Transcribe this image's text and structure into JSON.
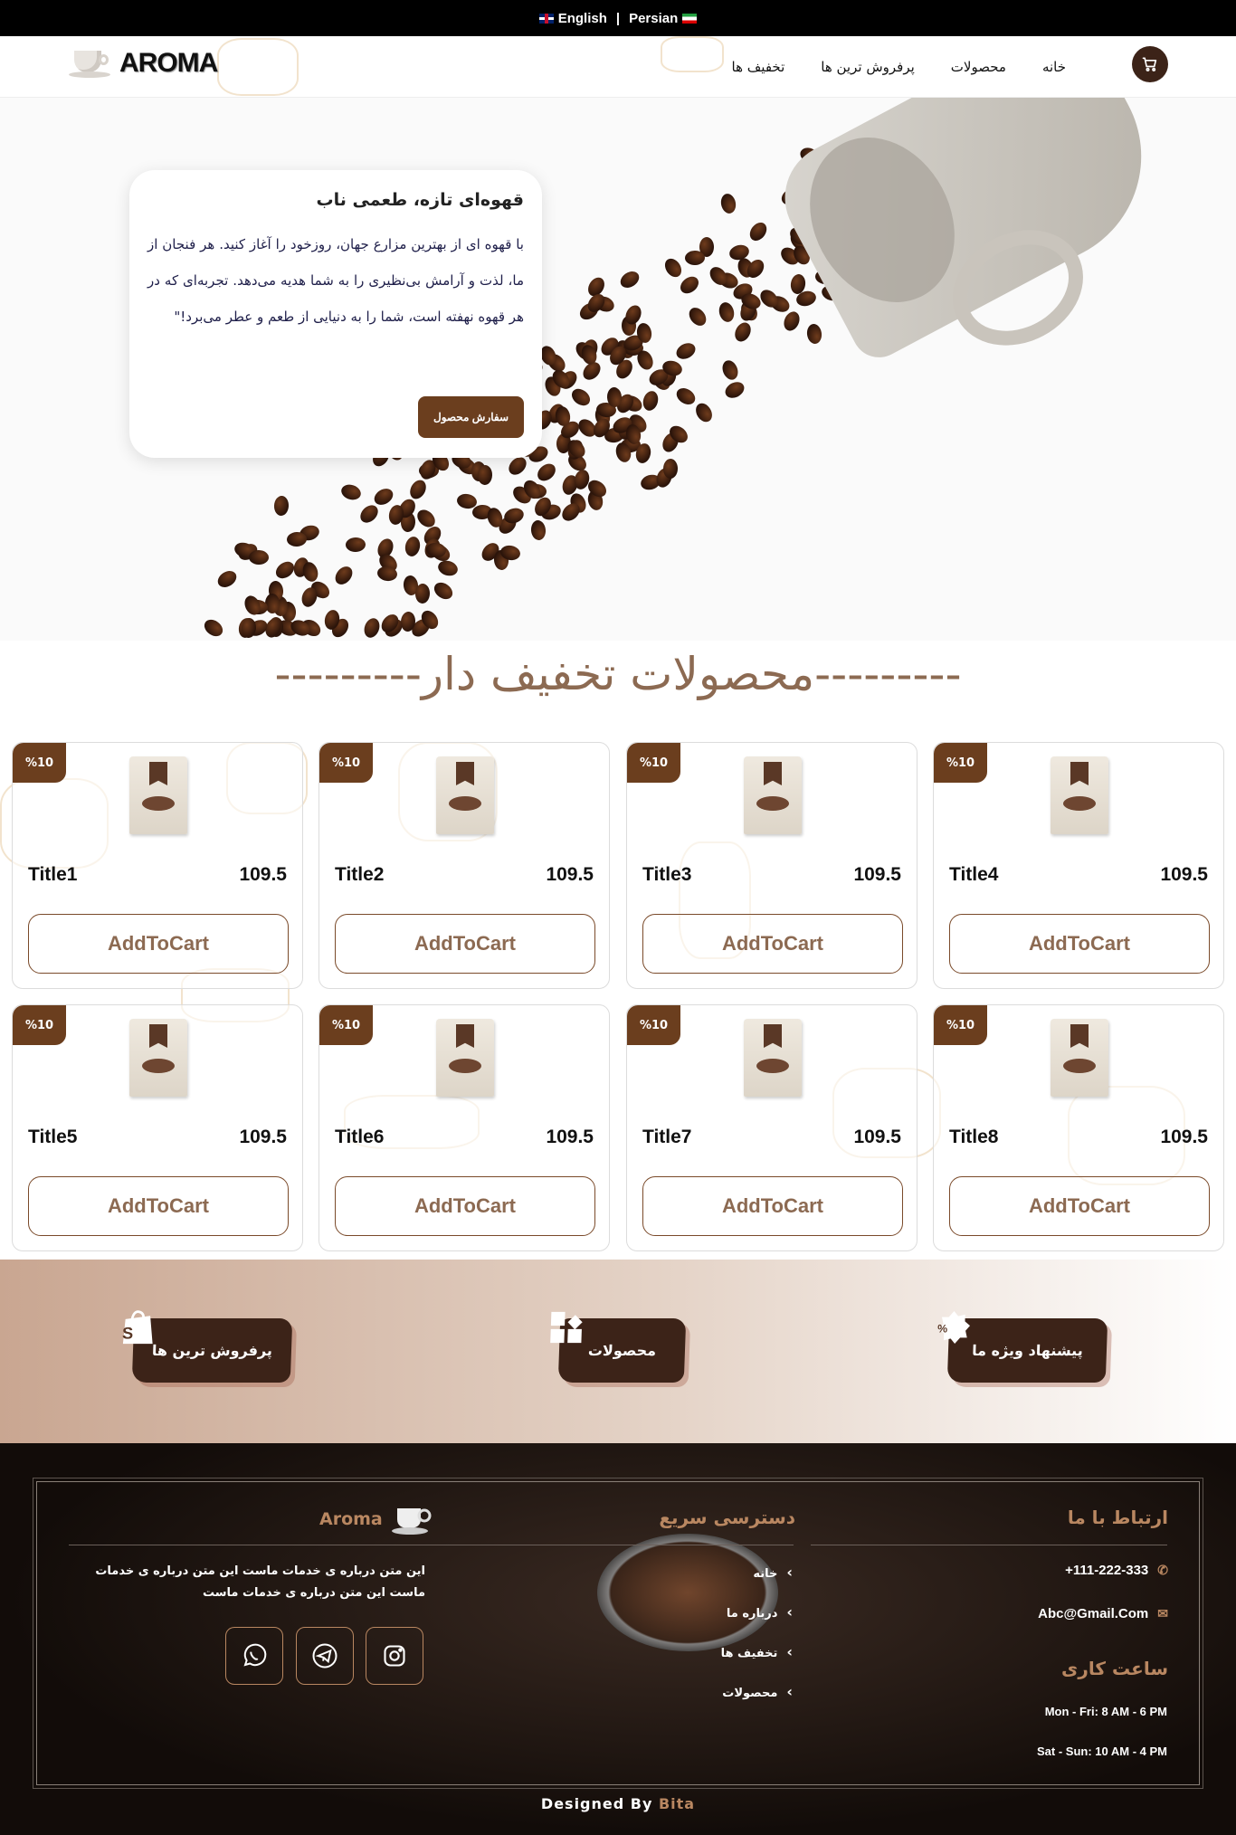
{
  "langbar": {
    "english": "English",
    "separator": "|",
    "persian": "Persian"
  },
  "navbar": {
    "brand": "AROMA",
    "links": [
      "خانه",
      "محصولات",
      "پرفروش ترین ها",
      "تخفیف ها"
    ],
    "cart_icon": "cart-icon"
  },
  "hero": {
    "title": "قهوه‌ای تازه، طعمی ناب",
    "text": "با قهوه ای از بهترین مزارع جهان، روزخود را آغاز کنید. هر فنجان از ما، لذت و آرامش بی‌نظیری را به شما هدیه می‌دهد. تجربه‌ای که در هر قهوه نهفته است، شما را به دنیایی از طعم و عطر می‌برد!\"",
    "button": "سفارش محصول"
  },
  "discount_section": {
    "title": "---------محصولات تخفیف دار---------"
  },
  "products": [
    {
      "badge": "%10",
      "title": "Title1",
      "price": "109.5",
      "button": "AddToCart"
    },
    {
      "badge": "%10",
      "title": "Title2",
      "price": "109.5",
      "button": "AddToCart"
    },
    {
      "badge": "%10",
      "title": "Title3",
      "price": "109.5",
      "button": "AddToCart"
    },
    {
      "badge": "%10",
      "title": "Title4",
      "price": "109.5",
      "button": "AddToCart"
    },
    {
      "badge": "%10",
      "title": "Title5",
      "price": "109.5",
      "button": "AddToCart"
    },
    {
      "badge": "%10",
      "title": "Title6",
      "price": "109.5",
      "button": "AddToCart"
    },
    {
      "badge": "%10",
      "title": "Title7",
      "price": "109.5",
      "button": "AddToCart"
    },
    {
      "badge": "%10",
      "title": "Title8",
      "price": "109.5",
      "button": "AddToCart"
    }
  ],
  "features": [
    {
      "label": "پرفروش ترین ها",
      "icon": "shopify-bag-icon"
    },
    {
      "label": "محصولات",
      "icon": "grid-icon"
    },
    {
      "label": "پیشنهاد ویژه ما",
      "icon": "discount-gear-icon"
    }
  ],
  "footer": {
    "contact_title": "ارتباط با ما",
    "phone": "+111-222-333",
    "email": "Abc@Gmail.Com",
    "hours_title": "ساعت کاری",
    "hours_weekday": "Mon - Fri: 8 AM - 6 PM",
    "hours_weekend": "Sat - Sun: 10 AM - 4 PM",
    "quick_title": "دسترسی سریع",
    "quick_links": [
      "خانه",
      "درباره ما",
      "تخفیف ها",
      "محصولات"
    ],
    "brand": "Aroma",
    "about": "این متن درباره ی خدمات ماست این متن درباره ی خدمات ماست این متن درباره ی خدمات ماست",
    "social": [
      "instagram-icon",
      "telegram-icon",
      "whatsapp-icon"
    ],
    "credit_prefix": "Designed By",
    "credit_name": "Bita"
  },
  "colors": {
    "brand_brown": "#6b3e1e",
    "dark_brown": "#3c2318",
    "accent_tan": "#b98761",
    "heading_tan": "#8c6a52"
  }
}
